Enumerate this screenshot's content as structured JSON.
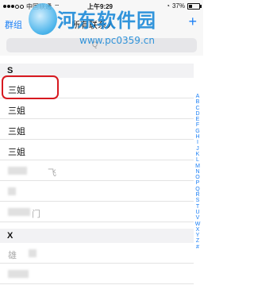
{
  "status_bar": {
    "carrier": "中国联通",
    "time": "上午9:29",
    "battery": "37%"
  },
  "nav": {
    "groups_label": "群组",
    "title": "所有联系人",
    "add_label": "+"
  },
  "watermark": {
    "title": "河东软件园",
    "url": "www.pc0359.cn"
  },
  "search": {
    "placeholder": "Q"
  },
  "sections": [
    {
      "letter": "S",
      "contacts": [
        "三姐",
        "三姐",
        "三姐",
        "三姐",
        "",
        "",
        ""
      ]
    },
    {
      "letter": "X",
      "contacts": [
        ""
      ]
    }
  ],
  "blurred_fragments": {
    "row5": "飞",
    "row7": "门",
    "row9": "雄"
  },
  "index_letters": [
    "A",
    "B",
    "C",
    "D",
    "E",
    "F",
    "G",
    "H",
    "I",
    "J",
    "K",
    "L",
    "M",
    "N",
    "O",
    "P",
    "Q",
    "R",
    "S",
    "T",
    "U",
    "V",
    "W",
    "X",
    "Y",
    "Z",
    "#"
  ]
}
